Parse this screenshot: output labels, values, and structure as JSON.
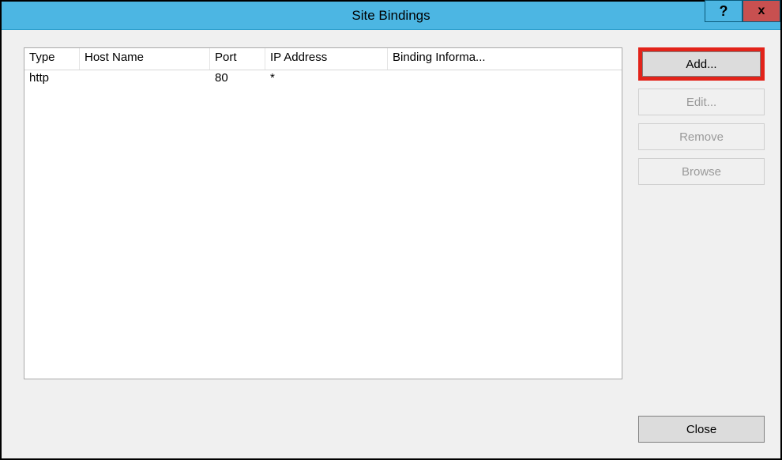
{
  "window": {
    "title": "Site Bindings",
    "help": "?",
    "close": "x"
  },
  "table": {
    "headers": {
      "type": "Type",
      "host": "Host Name",
      "port": "Port",
      "ip": "IP Address",
      "binding": "Binding Informa..."
    },
    "rows": [
      {
        "type": "http",
        "host": "",
        "port": "80",
        "ip": "*",
        "binding": ""
      }
    ]
  },
  "buttons": {
    "add": "Add...",
    "edit": "Edit...",
    "remove": "Remove",
    "browse": "Browse",
    "close": "Close"
  }
}
